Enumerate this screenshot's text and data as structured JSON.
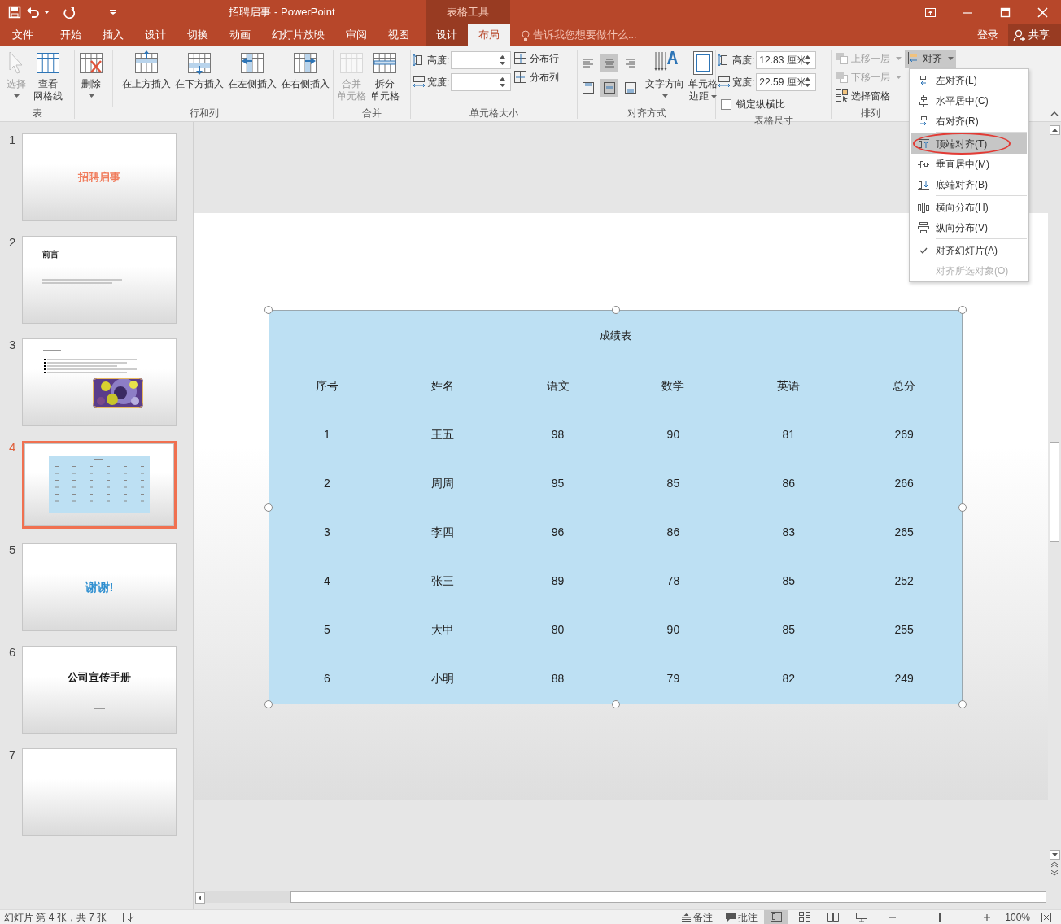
{
  "title_bar": {
    "document_title": "招聘启事 - PowerPoint",
    "context_label": "表格工具"
  },
  "tabs": [
    {
      "label": "文件",
      "selected": false,
      "kind": "main"
    },
    {
      "label": "开始",
      "selected": false,
      "kind": "main"
    },
    {
      "label": "插入",
      "selected": false,
      "kind": "main"
    },
    {
      "label": "设计",
      "selected": false,
      "kind": "main"
    },
    {
      "label": "切换",
      "selected": false,
      "kind": "main"
    },
    {
      "label": "动画",
      "selected": false,
      "kind": "main"
    },
    {
      "label": "幻灯片放映",
      "selected": false,
      "kind": "main"
    },
    {
      "label": "审阅",
      "selected": false,
      "kind": "main"
    },
    {
      "label": "视图",
      "selected": false,
      "kind": "main"
    },
    {
      "label": "设计",
      "selected": false,
      "kind": "contextual"
    },
    {
      "label": "布局",
      "selected": true,
      "kind": "contextual"
    }
  ],
  "tell_me": {
    "placeholder": "告诉我您想要做什么..."
  },
  "account": {
    "sign_in": "登录",
    "share": "共享"
  },
  "ribbon": {
    "groups": [
      {
        "label": "表",
        "columns": [
          [
            {
              "kind": "large",
              "lines": [
                "选择"
              ],
              "disabled": true,
              "dropdown": true
            }
          ],
          [
            {
              "kind": "large",
              "lines": [
                "查看",
                "网格线"
              ],
              "disabled": false,
              "dropdown": false
            }
          ]
        ]
      },
      {
        "label": "行和列",
        "columns": [
          [
            {
              "kind": "large",
              "lines": [
                "删除"
              ],
              "disabled": false,
              "dropdown": true
            }
          ],
          [
            {
              "kind": "large",
              "lines": [
                "在上方插入"
              ],
              "disabled": false,
              "dropdown": false
            }
          ],
          [
            {
              "kind": "large",
              "lines": [
                "在下方插入"
              ],
              "disabled": false,
              "dropdown": false
            }
          ],
          [
            {
              "kind": "large",
              "lines": [
                "在左侧插入"
              ],
              "disabled": false,
              "dropdown": false
            }
          ],
          [
            {
              "kind": "large",
              "lines": [
                "在右侧插入"
              ],
              "disabled": false,
              "dropdown": false
            }
          ]
        ]
      },
      {
        "label": "合并",
        "columns": [
          [
            {
              "kind": "large",
              "lines": [
                "合并",
                "单元格"
              ],
              "disabled": true,
              "dropdown": false
            }
          ],
          [
            {
              "kind": "large",
              "lines": [
                "拆分",
                "单元格"
              ],
              "disabled": false,
              "dropdown": false
            }
          ]
        ]
      },
      {
        "label": "单元格大小",
        "columns": [
          [
            {
              "kind": "field",
              "label": "高度:"
            },
            {
              "kind": "field",
              "label": "宽度:"
            }
          ],
          [
            {
              "kind": "small",
              "label": "分布行",
              "disabled": false,
              "dropdown": false,
              "expanded": false
            },
            {
              "kind": "small",
              "label": "分布列",
              "disabled": false,
              "dropdown": false,
              "expanded": false
            }
          ]
        ]
      },
      {
        "label": "对齐方式",
        "columns": [
          [
            {
              "kind": "align",
              "selected": false
            },
            {
              "kind": "align",
              "selected": true
            },
            {
              "kind": "align",
              "selected": false
            },
            {
              "kind": "align",
              "selected": false
            },
            {
              "kind": "align",
              "selected": true
            },
            {
              "kind": "align",
              "selected": false
            }
          ],
          [
            {
              "kind": "large",
              "lines": [
                "文字方向"
              ],
              "disabled": false,
              "dropdown": true
            }
          ],
          [
            {
              "kind": "large",
              "lines": [
                "单元格",
                "边距"
              ],
              "disabled": false,
              "dropdown": true
            }
          ]
        ]
      },
      {
        "label": "表格尺寸",
        "columns": [
          [
            {
              "kind": "field",
              "label": "高度:",
              "value": "12.83 厘米"
            },
            {
              "kind": "field",
              "label": "宽度:",
              "value": "22.59 厘米"
            },
            {
              "kind": "checkbox",
              "label": "锁定纵横比",
              "checked": false
            }
          ]
        ]
      },
      {
        "label": "排列",
        "columns": [
          [
            {
              "kind": "small",
              "label": "上移一层",
              "disabled": true,
              "dropdown": true,
              "expanded": false
            },
            {
              "kind": "small",
              "label": "下移一层",
              "disabled": true,
              "dropdown": true,
              "expanded": false
            },
            {
              "kind": "small",
              "label": "选择窗格",
              "disabled": false,
              "dropdown": false,
              "expanded": false
            }
          ],
          [
            {
              "kind": "small",
              "label": "对齐",
              "disabled": false,
              "dropdown": true,
              "expanded": true
            }
          ]
        ]
      }
    ]
  },
  "align_menu": {
    "sections": [
      [
        {
          "label": "左对齐(L)",
          "selected": false,
          "checked": false,
          "disabled": false,
          "circled": false
        },
        {
          "label": "水平居中(C)",
          "selected": false,
          "checked": false,
          "disabled": false,
          "circled": false
        },
        {
          "label": "右对齐(R)",
          "selected": false,
          "checked": false,
          "disabled": false,
          "circled": false
        }
      ],
      [
        {
          "label": "顶端对齐(T)",
          "selected": true,
          "checked": false,
          "disabled": false,
          "circled": true
        },
        {
          "label": "垂直居中(M)",
          "selected": false,
          "checked": false,
          "disabled": false,
          "circled": false
        },
        {
          "label": "底端对齐(B)",
          "selected": false,
          "checked": false,
          "disabled": false,
          "circled": false
        }
      ],
      [
        {
          "label": "横向分布(H)",
          "selected": false,
          "checked": false,
          "disabled": false,
          "circled": false
        },
        {
          "label": "纵向分布(V)",
          "selected": false,
          "checked": false,
          "disabled": false,
          "circled": false
        }
      ],
      [
        {
          "label": "对齐幻灯片(A)",
          "selected": false,
          "checked": true,
          "disabled": false,
          "circled": false
        },
        {
          "label": "对齐所选对象(O)",
          "selected": false,
          "checked": false,
          "disabled": true,
          "circled": false
        }
      ]
    ]
  },
  "slides": [
    {
      "number": "1",
      "selected": false,
      "kind": "title",
      "title": "招聘启事",
      "color": "#f07c5c"
    },
    {
      "number": "2",
      "selected": false,
      "kind": "heading",
      "title": "前言"
    },
    {
      "number": "3",
      "selected": false,
      "kind": "bullets"
    },
    {
      "number": "4",
      "selected": true,
      "kind": "table"
    },
    {
      "number": "5",
      "selected": false,
      "kind": "title",
      "title": "谢谢!",
      "color": "#2f8fd0"
    },
    {
      "number": "6",
      "selected": false,
      "kind": "title_subtitle",
      "title": "公司宣传手册",
      "color": "#1a1a1a"
    },
    {
      "number": "7",
      "selected": false,
      "kind": "blank"
    }
  ],
  "table": {
    "title": "成绩表",
    "columns": [
      "序号",
      "姓名",
      "语文",
      "数学",
      "英语",
      "总分"
    ],
    "rows": [
      [
        "1",
        "王五",
        "98",
        "90",
        "81",
        "269"
      ],
      [
        "2",
        "周周",
        "95",
        "85",
        "86",
        "266"
      ],
      [
        "3",
        "李四",
        "96",
        "86",
        "83",
        "265"
      ],
      [
        "4",
        "张三",
        "89",
        "78",
        "85",
        "252"
      ],
      [
        "5",
        "大甲",
        "80",
        "90",
        "85",
        "255"
      ],
      [
        "6",
        "小明",
        "88",
        "79",
        "82",
        "249"
      ]
    ]
  },
  "status_bar": {
    "slide_info": "幻灯片 第 4 张，共 7 张",
    "notes": "备注",
    "comments": "批注",
    "views": [
      {
        "selected": true
      },
      {
        "selected": false
      },
      {
        "selected": false
      },
      {
        "selected": false
      }
    ],
    "zoom": {
      "level": 0.5,
      "reading": "100%"
    }
  }
}
